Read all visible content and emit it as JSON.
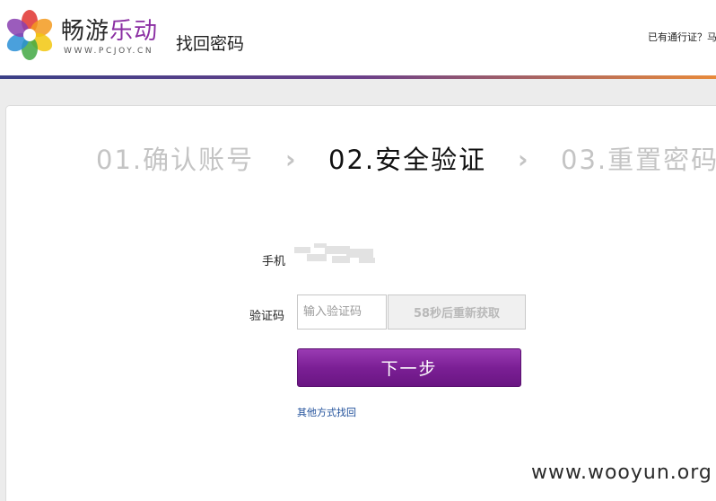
{
  "header": {
    "logo_main": "畅游",
    "logo_accent": "乐动",
    "logo_subtitle": "WWW.PCJOY.CN",
    "page_title": "找回密码",
    "account_prompt": "已有通行证？马"
  },
  "steps": [
    {
      "label": "01.确认账号",
      "state": "done"
    },
    {
      "label": "02.安全验证",
      "state": "current"
    },
    {
      "label": "03.重置密码",
      "state": "todo"
    }
  ],
  "step_separator": "›",
  "form": {
    "phone_label": "手机",
    "code_label": "验证码",
    "code_placeholder": "输入验证码",
    "code_value": "",
    "resend_label": "58秒后重新获取",
    "next_label": "下一步",
    "alt_link": "其他方式找回"
  },
  "watermark": "www.wooyun.org",
  "colors": {
    "brand_purple": "#7b1f95",
    "link_blue": "#1f4f9a",
    "inactive_step": "#c4c4c4"
  }
}
